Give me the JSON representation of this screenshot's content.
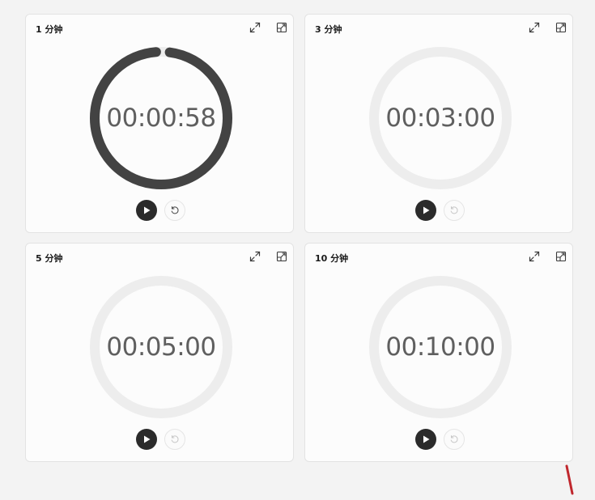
{
  "colors": {
    "background": "#f3f3f3",
    "card": "#fcfcfc",
    "ring_track": "#ededed",
    "ring_progress": "#434343",
    "time_text": "#5f5f5f",
    "play_button": "#2b2b2b"
  },
  "timers": [
    {
      "title": "1 分钟",
      "time": "00:00:58",
      "remaining_fraction": 0.967,
      "running": true,
      "reset_enabled": true,
      "expand_icon": "expand-icon",
      "pin_icon": "keep-on-top-icon"
    },
    {
      "title": "3 分钟",
      "time": "00:03:00",
      "remaining_fraction": 1.0,
      "running": false,
      "reset_enabled": false,
      "expand_icon": "expand-icon",
      "pin_icon": "keep-on-top-icon"
    },
    {
      "title": "5 分钟",
      "time": "00:05:00",
      "remaining_fraction": 1.0,
      "running": false,
      "reset_enabled": false,
      "expand_icon": "expand-icon",
      "pin_icon": "keep-on-top-icon"
    },
    {
      "title": "10 分钟",
      "time": "00:10:00",
      "remaining_fraction": 1.0,
      "running": false,
      "reset_enabled": false,
      "expand_icon": "expand-icon",
      "pin_icon": "keep-on-top-icon"
    }
  ]
}
